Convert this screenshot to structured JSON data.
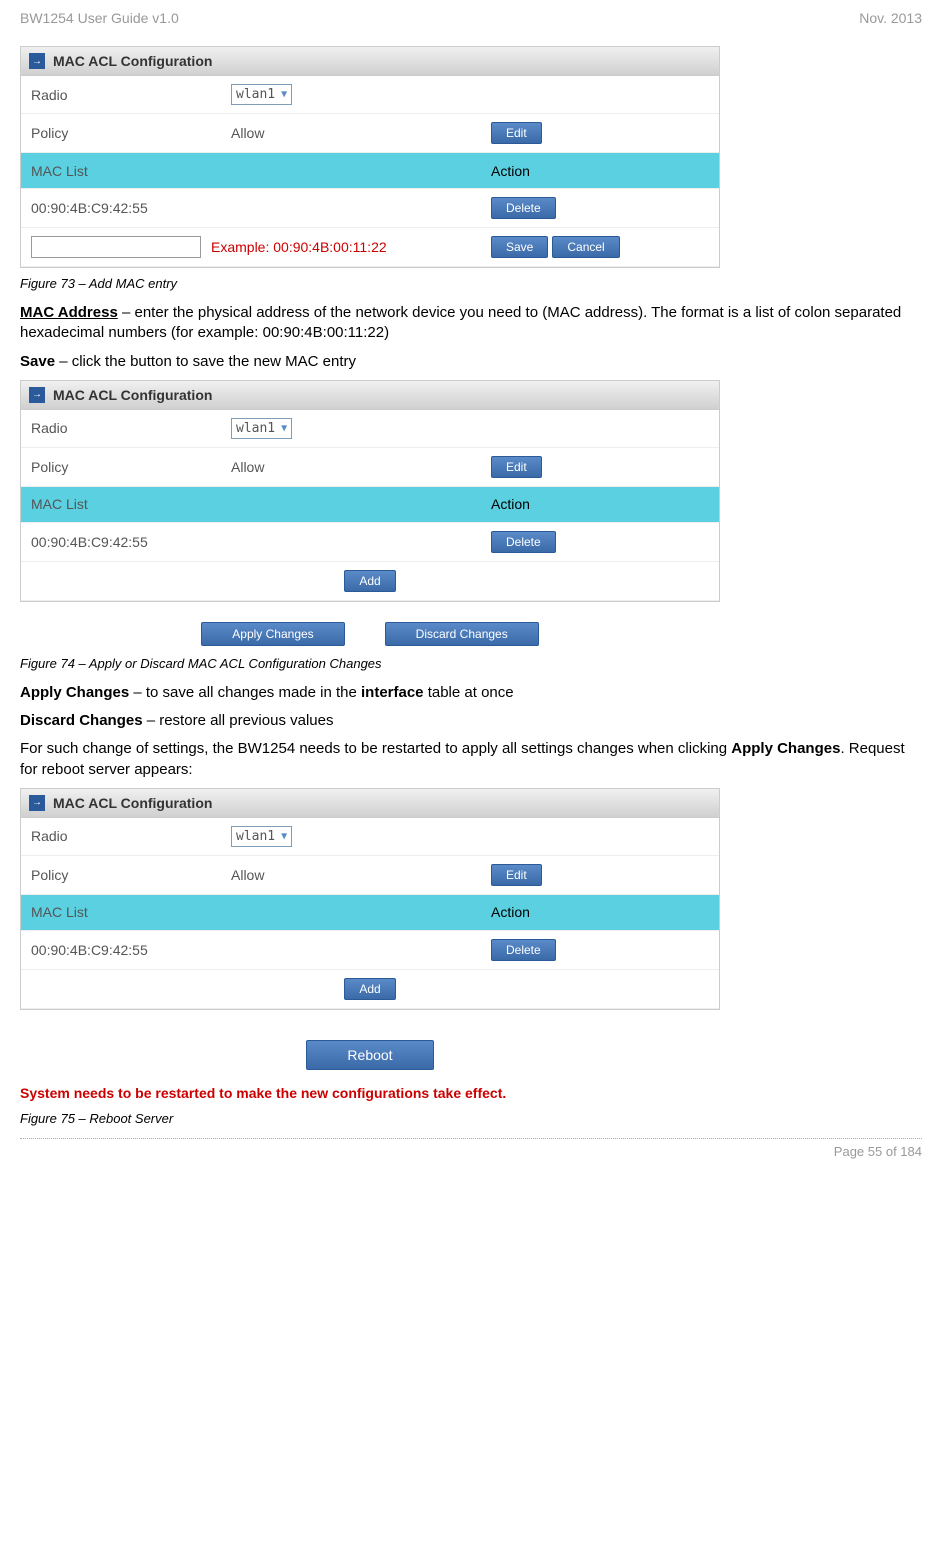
{
  "header": {
    "left": "BW1254 User Guide v1.0",
    "right": "Nov.  2013"
  },
  "panel1": {
    "title": "MAC ACL Configuration",
    "radio_label": "Radio",
    "radio_value": "wlan1",
    "policy_label": "Policy",
    "policy_value": "Allow",
    "edit_btn": "Edit",
    "maclist_header": "MAC List",
    "action_header": "Action",
    "mac_entry": "00:90:4B:C9:42:55",
    "delete_btn": "Delete",
    "example_text": "Example: 00:90:4B:00:11:22",
    "save_btn": "Save",
    "cancel_btn": "Cancel"
  },
  "figure73_caption": "Figure 73 – Add MAC entry",
  "text1_bold": "MAC Address",
  "text1_rest": " – enter the physical address of the network device you need to (MAC address). The format is a list of colon separated hexadecimal numbers (for example: 00:90:4B:00:11:22)",
  "text2_bold": "Save",
  "text2_rest": " – click the button to save the new MAC entry",
  "panel2": {
    "title": "MAC ACL Configuration",
    "radio_label": "Radio",
    "radio_value": "wlan1",
    "policy_label": "Policy",
    "policy_value": "Allow",
    "edit_btn": "Edit",
    "maclist_header": "MAC List",
    "action_header": "Action",
    "mac_entry": "00:90:4B:C9:42:55",
    "delete_btn": "Delete",
    "add_btn": "Add"
  },
  "apply_btn": "Apply Changes",
  "discard_btn": "Discard Changes",
  "figure74_caption": "Figure 74 – Apply or Discard MAC ACL Configuration Changes",
  "text3_bold": "Apply Changes",
  "text3_mid": " – to save all changes made in the ",
  "text3_bold2": "interface",
  "text3_end": " table at once",
  "text4_bold": "Discard Changes",
  "text4_rest": " – restore all previous values",
  "text5_start": "For such change of settings, the BW1254 needs to be restarted to apply all settings changes when clicking ",
  "text5_bold": "Apply Changes",
  "text5_end": ". Request for reboot server appears:",
  "panel3": {
    "title": "MAC ACL Configuration",
    "radio_label": "Radio",
    "radio_value": "wlan1",
    "policy_label": "Policy",
    "policy_value": "Allow",
    "edit_btn": "Edit",
    "maclist_header": "MAC List",
    "action_header": "Action",
    "mac_entry": "00:90:4B:C9:42:55",
    "delete_btn": "Delete",
    "add_btn": "Add"
  },
  "reboot_btn": "Reboot",
  "warning_text": "System needs to be restarted to make the new configurations take effect.",
  "figure75_caption": "Figure 75 – Reboot Server",
  "footer": "Page 55 of 184"
}
